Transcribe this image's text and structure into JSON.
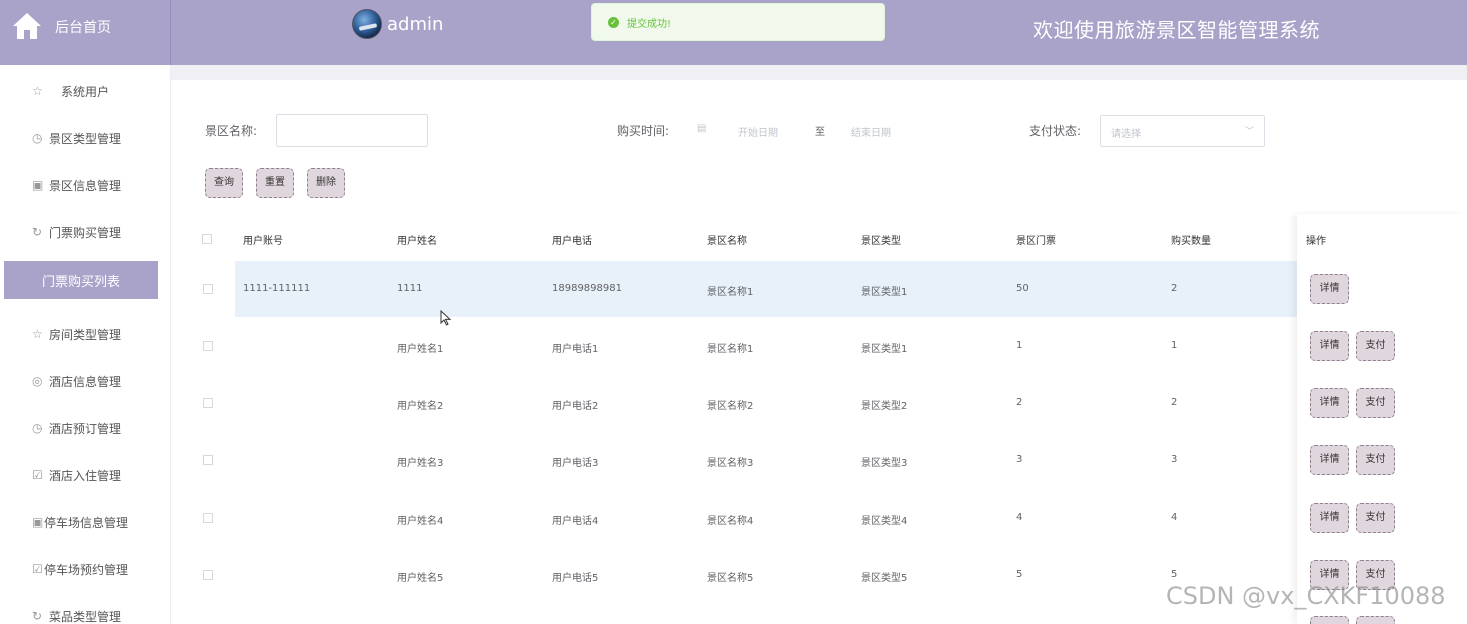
{
  "header": {
    "home_label": "后台首页",
    "username": "admin",
    "app_title": "欢迎使用旅游景区智能管理系统",
    "accent_color": "#a9a3c9"
  },
  "toast": {
    "message": "提交成功!",
    "type": "success",
    "color": "#67c23a"
  },
  "sidebar": {
    "items": [
      {
        "label": "系统用户",
        "icon": "star-icon"
      },
      {
        "label": "景区类型管理",
        "icon": "clock-icon"
      },
      {
        "label": "景区信息管理",
        "icon": "box-icon"
      },
      {
        "label": "门票购买管理",
        "icon": "refresh-icon"
      },
      {
        "label": "门票购买列表",
        "icon": "",
        "active": true
      },
      {
        "label": "房间类型管理",
        "icon": "star-icon"
      },
      {
        "label": "酒店信息管理",
        "icon": "compass-icon"
      },
      {
        "label": "酒店预订管理",
        "icon": "clock-icon"
      },
      {
        "label": "酒店入住管理",
        "icon": "calendar-check-icon"
      },
      {
        "label": "停车场信息管理",
        "icon": "box-icon"
      },
      {
        "label": "停车场预约管理",
        "icon": "calendar-check-icon"
      },
      {
        "label": "菜品类型管理",
        "icon": "refresh-icon"
      }
    ]
  },
  "filters": {
    "scenic_name_label": "景区名称:",
    "scenic_name_value": "",
    "purchase_time_label": "购买时间:",
    "start_date_placeholder": "开始日期",
    "range_separator": "至",
    "end_date_placeholder": "结束日期",
    "pay_status_label": "支付状态:",
    "pay_status_placeholder": "请选择"
  },
  "actions": {
    "search": "查询",
    "reset": "重置",
    "delete": "删除"
  },
  "table": {
    "columns": [
      "用户账号",
      "用户姓名",
      "用户电话",
      "景区名称",
      "景区类型",
      "景区门票",
      "购买数量",
      "操作"
    ],
    "rows": [
      {
        "account": "1111-111111",
        "name": "1111",
        "phone": "18989898981",
        "scenic": "景区名称1",
        "type": "景区类型1",
        "ticket": "50",
        "qty": "2",
        "detail": "详情",
        "pay": ""
      },
      {
        "account": "",
        "name": "用户姓名1",
        "phone": "用户电话1",
        "scenic": "景区名称1",
        "type": "景区类型1",
        "ticket": "1",
        "qty": "1",
        "detail": "详情",
        "pay": "支付"
      },
      {
        "account": "",
        "name": "用户姓名2",
        "phone": "用户电话2",
        "scenic": "景区名称2",
        "type": "景区类型2",
        "ticket": "2",
        "qty": "2",
        "detail": "详情",
        "pay": "支付"
      },
      {
        "account": "",
        "name": "用户姓名3",
        "phone": "用户电话3",
        "scenic": "景区名称3",
        "type": "景区类型3",
        "ticket": "3",
        "qty": "3",
        "detail": "详情",
        "pay": "支付"
      },
      {
        "account": "",
        "name": "用户姓名4",
        "phone": "用户电话4",
        "scenic": "景区名称4",
        "type": "景区类型4",
        "ticket": "4",
        "qty": "4",
        "detail": "详情",
        "pay": "支付"
      },
      {
        "account": "",
        "name": "用户姓名5",
        "phone": "用户电话5",
        "scenic": "景区名称5",
        "type": "景区类型5",
        "ticket": "5",
        "qty": "5",
        "detail": "详情",
        "pay": "支付"
      }
    ]
  },
  "watermark": "CSDN @vx_CXKF10088"
}
